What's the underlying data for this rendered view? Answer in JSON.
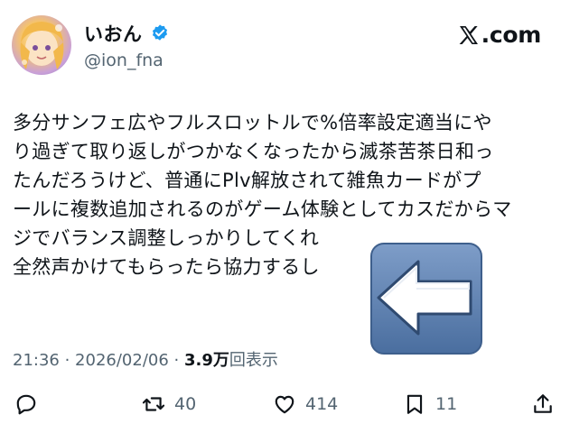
{
  "author": {
    "display_name": "いおん",
    "handle": "@ion_fna",
    "verified": true
  },
  "brand": {
    "label": ".com"
  },
  "tweet": {
    "lines": [
      "多分サンフェ広やフルスロットルで%倍率設定適当にや",
      "り過ぎて取り返しがつかなくなったから滅茶苦茶日和っ",
      "たんだろうけど、普通にPlv解放されて雑魚カードがプ",
      "ールに複数追加されるのがゲーム体験としてカスだからマ",
      "ジでバランス調整しっかりしてくれ",
      "全然声かけてもらったら協力するし"
    ]
  },
  "meta": {
    "time": "21:36",
    "sep1": " · ",
    "date": "2026/02/06",
    "sep2": " · ",
    "views_count": "3.9万",
    "views_label": "回表示"
  },
  "actions": {
    "reply": {
      "icon": "reply-icon",
      "count": ""
    },
    "retweet": {
      "icon": "retweet-icon",
      "count": "40"
    },
    "like": {
      "icon": "heart-icon",
      "count": "414"
    },
    "bookmark": {
      "icon": "bookmark-icon",
      "count": "11"
    },
    "share": {
      "icon": "share-icon",
      "count": ""
    }
  },
  "colors": {
    "text": "#0f1419",
    "muted": "#536471",
    "verified": "#1d9bf0",
    "arrow_tile": "#5b7fb0"
  }
}
